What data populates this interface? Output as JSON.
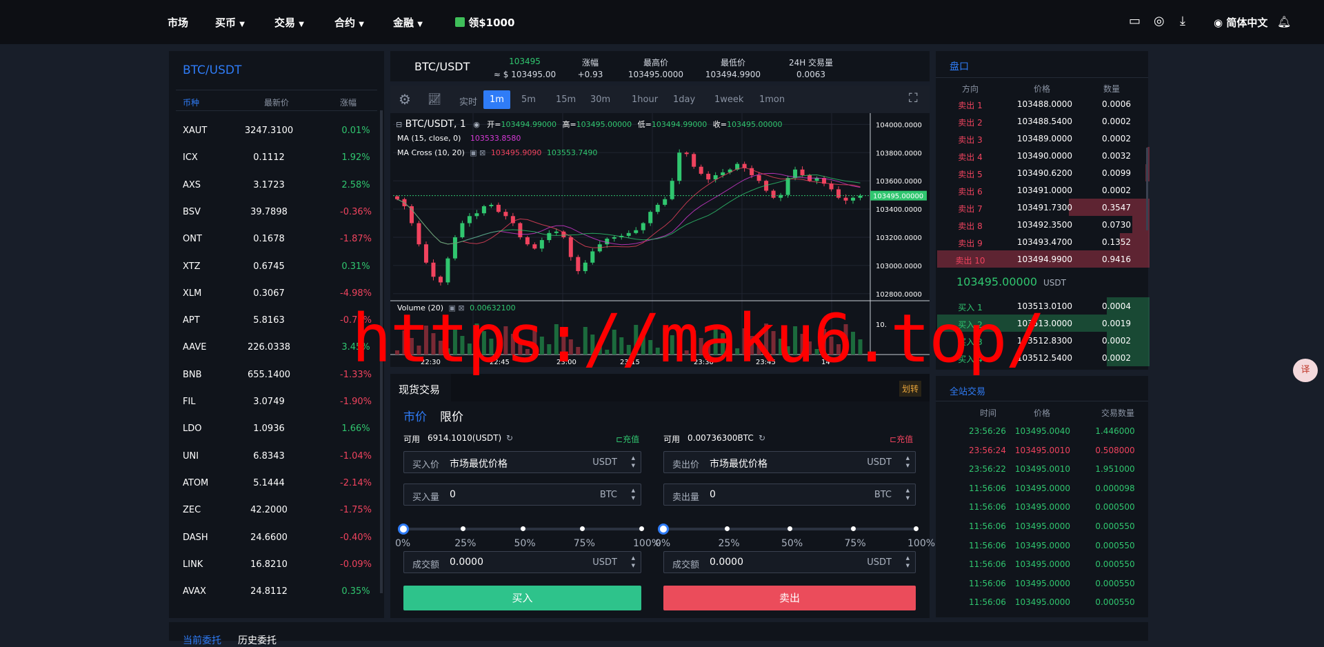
{
  "nav": {
    "items": [
      "市场",
      "买币",
      "交易",
      "合约",
      "金融"
    ],
    "promo": "领$1000",
    "language": "简体中文"
  },
  "market_list": {
    "title": "BTC/USDT",
    "headers": {
      "coin": "币种",
      "price": "最新价",
      "change": "涨幅"
    },
    "rows": [
      {
        "coin": "XAUT",
        "price": "3247.3100",
        "change": "0.01%",
        "dir": "up"
      },
      {
        "coin": "ICX",
        "price": "0.1112",
        "change": "1.92%",
        "dir": "up"
      },
      {
        "coin": "AXS",
        "price": "3.1723",
        "change": "2.58%",
        "dir": "up"
      },
      {
        "coin": "BSV",
        "price": "39.7898",
        "change": "-0.36%",
        "dir": "down"
      },
      {
        "coin": "ONT",
        "price": "0.1678",
        "change": "-1.87%",
        "dir": "down"
      },
      {
        "coin": "XTZ",
        "price": "0.6745",
        "change": "0.31%",
        "dir": "up"
      },
      {
        "coin": "XLM",
        "price": "0.3067",
        "change": "-4.98%",
        "dir": "down"
      },
      {
        "coin": "APT",
        "price": "5.8163",
        "change": "-0.71%",
        "dir": "down"
      },
      {
        "coin": "AAVE",
        "price": "226.0338",
        "change": "3.45%",
        "dir": "up"
      },
      {
        "coin": "BNB",
        "price": "655.1400",
        "change": "-1.33%",
        "dir": "down"
      },
      {
        "coin": "FIL",
        "price": "3.0749",
        "change": "-1.90%",
        "dir": "down"
      },
      {
        "coin": "LDO",
        "price": "1.0936",
        "change": "1.66%",
        "dir": "up"
      },
      {
        "coin": "UNI",
        "price": "6.8343",
        "change": "-1.04%",
        "dir": "down"
      },
      {
        "coin": "ATOM",
        "price": "5.1444",
        "change": "-2.14%",
        "dir": "down"
      },
      {
        "coin": "ZEC",
        "price": "42.2000",
        "change": "-1.75%",
        "dir": "down"
      },
      {
        "coin": "DASH",
        "price": "24.6600",
        "change": "-0.40%",
        "dir": "down"
      },
      {
        "coin": "LINK",
        "price": "16.8210",
        "change": "-0.09%",
        "dir": "down"
      },
      {
        "coin": "AVAX",
        "price": "24.8112",
        "change": "0.35%",
        "dir": "up"
      }
    ]
  },
  "pair_info": {
    "pair": "BTC/USDT",
    "price": "103495",
    "price_usd": "≈ $ 103495.00",
    "change_label": "涨幅",
    "change": "+0.93",
    "high_label": "最高价",
    "high": "103495.0000",
    "low_label": "最低价",
    "low": "103494.9900",
    "vol_label": "24H 交易量",
    "vol": "0.0063"
  },
  "chart_toolbar": {
    "timeframes": [
      "实时",
      "1m",
      "5m",
      "15m",
      "30m",
      "1hour",
      "1day",
      "1week",
      "1mon"
    ],
    "active": "1m"
  },
  "chart_legend": {
    "symbol": "BTC/USDT, 1",
    "open_label": "开=",
    "open": "103494.99000",
    "high_label": "高=",
    "high": "103495.00000",
    "low_label": "低=",
    "low": "103494.99000",
    "close_label": "收=",
    "close": "103495.00000",
    "ma_label": "MA (15, close, 0)",
    "ma_value": "103533.8580",
    "macross_label": "MA Cross (10, 20)",
    "macross_v1": "103495.9090",
    "macross_v2": "103553.7490",
    "volume_label": "Volume (20)",
    "volume_value": "0.00632100",
    "vol_axis_label": "10.",
    "last_price_tag": "103495.00000"
  },
  "chart_data": {
    "type": "candlestick",
    "price_axis": [
      "104000.0000",
      "103800.0000",
      "103600.0000",
      "103400.0000",
      "103200.0000",
      "103000.0000",
      "102800.0000"
    ],
    "ylim": [
      102750,
      104080
    ],
    "time_labels": [
      "22:30",
      "22:45",
      "23:00",
      "23:15",
      "23:30",
      "23:45",
      "14"
    ],
    "close_path": [
      103470,
      103420,
      103300,
      103150,
      103020,
      102920,
      102880,
      103050,
      103200,
      103300,
      103350,
      103370,
      103420,
      103430,
      103380,
      103350,
      103300,
      103200,
      103150,
      103120,
      103180,
      103230,
      103240,
      103200,
      103060,
      102960,
      103020,
      103100,
      103150,
      103190,
      103200,
      103210,
      103230,
      103250,
      103300,
      103380,
      103430,
      103470,
      103600,
      103800,
      103790,
      103700,
      103650,
      103610,
      103640,
      103660,
      103680,
      103720,
      103690,
      103640,
      103600,
      103530,
      103480,
      103500,
      103620,
      103680,
      103640,
      103600,
      103620,
      103580,
      103540,
      103480,
      103460,
      103480,
      103495
    ]
  },
  "order_book": {
    "title": "盘口",
    "headers": {
      "side": "方向",
      "price": "价格",
      "qty": "数量"
    },
    "asks": [
      {
        "side": "卖出 1",
        "price": "103488.0000",
        "qty": "0.0006",
        "depth": 0
      },
      {
        "side": "卖出 2",
        "price": "103488.5400",
        "qty": "0.0002",
        "depth": 0
      },
      {
        "side": "卖出 3",
        "price": "103489.0000",
        "qty": "0.0002",
        "depth": 0
      },
      {
        "side": "卖出 4",
        "price": "103490.0000",
        "qty": "0.0032",
        "depth": 0.01
      },
      {
        "side": "卖出 5",
        "price": "103490.6200",
        "qty": "0.0099",
        "depth": 0.02
      },
      {
        "side": "卖出 6",
        "price": "103491.0000",
        "qty": "0.0002",
        "depth": 0
      },
      {
        "side": "卖出 7",
        "price": "103491.7300",
        "qty": "0.3547",
        "depth": 0.38
      },
      {
        "side": "卖出 8",
        "price": "103492.3500",
        "qty": "0.0730",
        "depth": 0.08
      },
      {
        "side": "卖出 9",
        "price": "103493.4700",
        "qty": "0.1352",
        "depth": 0.14
      },
      {
        "side": "卖出 10",
        "price": "103494.9900",
        "qty": "0.9416",
        "depth": 1
      }
    ],
    "mid_price": "103495.00000",
    "mid_unit": "USDT",
    "bids": [
      {
        "side": "买入 1",
        "price": "103513.0100",
        "qty": "0.0004",
        "depth": 0.2
      },
      {
        "side": "买入 2",
        "price": "103513.0000",
        "qty": "0.0019",
        "depth": 1
      },
      {
        "side": "买入 3",
        "price": "103512.8300",
        "qty": "0.0002",
        "depth": 0.2
      },
      {
        "side": "买入 4",
        "price": "103512.5400",
        "qty": "0.0002",
        "depth": 0.2
      }
    ]
  },
  "trades": {
    "title": "全站交易",
    "headers": {
      "time": "时间",
      "price": "价格",
      "qty": "交易数量"
    },
    "rows": [
      {
        "time": "23:56:26",
        "price": "103495.0040",
        "qty": "1.446000",
        "dir": "up"
      },
      {
        "time": "23:56:24",
        "price": "103495.0010",
        "qty": "0.508000",
        "dir": "down"
      },
      {
        "time": "23:56:22",
        "price": "103495.0010",
        "qty": "1.951000",
        "dir": "up"
      },
      {
        "time": "11:56:06",
        "price": "103495.0000",
        "qty": "0.000098",
        "dir": "up"
      },
      {
        "time": "11:56:06",
        "price": "103495.0000",
        "qty": "0.000500",
        "dir": "up"
      },
      {
        "time": "11:56:06",
        "price": "103495.0000",
        "qty": "0.000550",
        "dir": "up"
      },
      {
        "time": "11:56:06",
        "price": "103495.0000",
        "qty": "0.000550",
        "dir": "up"
      },
      {
        "time": "11:56:06",
        "price": "103495.0000",
        "qty": "0.000550",
        "dir": "up"
      },
      {
        "time": "11:56:06",
        "price": "103495.0000",
        "qty": "0.000550",
        "dir": "up"
      },
      {
        "time": "11:56:06",
        "price": "103495.0000",
        "qty": "0.000550",
        "dir": "up"
      }
    ]
  },
  "spot": {
    "title": "现货交易",
    "transfer": "划转",
    "tab_market": "市价",
    "tab_limit": "限价",
    "buy": {
      "avail_label": "可用",
      "avail": "6914.1010(USDT)",
      "deposit": "充值",
      "price_label": "买入价",
      "price_value": "市场最优价格",
      "price_unit": "USDT",
      "qty_label": "买入量",
      "qty_value": "0",
      "qty_unit": "BTC",
      "amount_label": "成交额",
      "amount_value": "0.0000",
      "amount_unit": "USDT",
      "button": "买入"
    },
    "sell": {
      "avail_label": "可用",
      "avail": "0.00736300BTC",
      "deposit": "充值",
      "price_label": "卖出价",
      "price_value": "市场最优价格",
      "price_unit": "USDT",
      "qty_label": "卖出量",
      "qty_value": "0",
      "qty_unit": "BTC",
      "amount_label": "成交额",
      "amount_value": "0.0000",
      "amount_unit": "USDT",
      "button": "卖出"
    },
    "percents": [
      "0%",
      "25%",
      "50%",
      "75%",
      "100%"
    ],
    "slider_value": 0
  },
  "bottom_tabs": [
    "当前委托",
    "历史委托"
  ],
  "watermark": "https://maku6.top/",
  "colors": {
    "up": "#30c66f",
    "down": "#f0435e",
    "accent": "#2f7cf7",
    "buy_button": "#2ec38b",
    "sell_button": "#eb4c5b"
  }
}
